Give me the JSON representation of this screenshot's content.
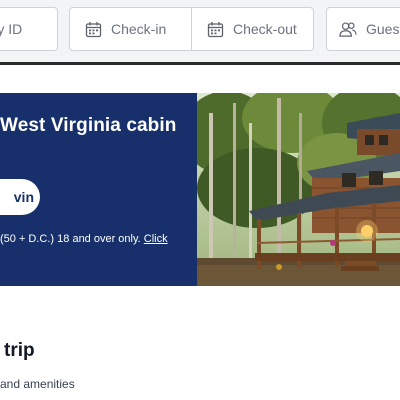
{
  "search": {
    "property_id_label": "erty ID",
    "check_in_label": "Check-in",
    "check_out_label": "Check-out",
    "guests_label": "Guests"
  },
  "icons": {
    "check_in": "calendar-icon",
    "check_out": "calendar-icon",
    "guests": "users-icon"
  },
  "promo": {
    "title": "West Virginia cabin",
    "button_label": "vin",
    "note_text": "(50 + D.C.) 18 and over only.",
    "note_link": "Click",
    "image": "log-cabin-in-forest-photo"
  },
  "section": {
    "title": "trip",
    "subtitle": "and amenities"
  },
  "colors": {
    "promo_background": "#17306b",
    "search_background": "#f3f4f6"
  }
}
